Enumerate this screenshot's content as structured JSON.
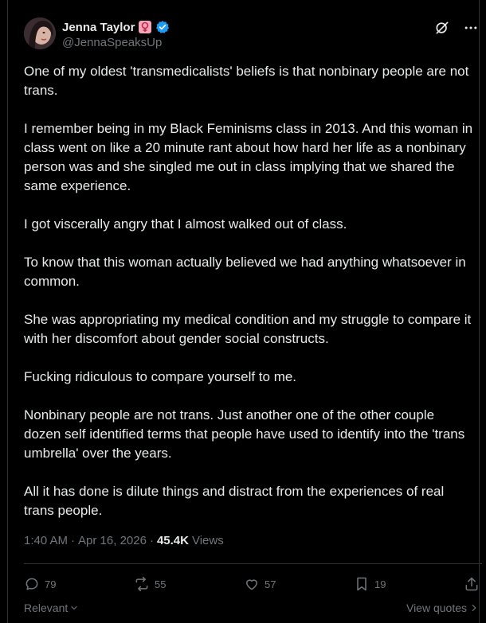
{
  "author": {
    "name": "Jenna Taylor",
    "handle": "@JennaSpeaksUp"
  },
  "body": {
    "paragraphs": [
      "One of my oldest 'transmedicalists' beliefs is that nonbinary people are not trans.",
      "I remember being in my Black Feminisms class in 2013. And this woman in class went on like a 20 minute rant about how hard her life as a nonbinary person was and she singled me out in class implying that we shared the same experience.",
      "I got viscerally angry that I almost walked out of class.",
      "To know that this woman actually believed we had anything whatsoever in common.",
      "She was appropriating my medical condition and my struggle to compare it with her discomfort about gender social constructs.",
      "Fucking ridiculous to compare yourself to me.",
      "Nonbinary people are not trans. Just another one of the other couple dozen self identified terms that people have used to identify into the 'trans umbrella' over the years.",
      "All it has done is dilute things and distract from the experiences of real trans people."
    ]
  },
  "meta": {
    "time": "1:40 AM",
    "date": "Apr 16, 2026",
    "separator": "·",
    "views_count": "45.4K",
    "views_label": "Views"
  },
  "actions": {
    "replies": "79",
    "reposts": "55",
    "likes": "57",
    "bookmarks": "19"
  },
  "footer": {
    "relevant": "Relevant",
    "view_quotes": "View quotes"
  },
  "colors": {
    "background": "#000000",
    "text": "#e7e9ea",
    "muted": "#71767b",
    "verified": "#1d9bf0",
    "badge_pink": "#f4a6b8"
  }
}
